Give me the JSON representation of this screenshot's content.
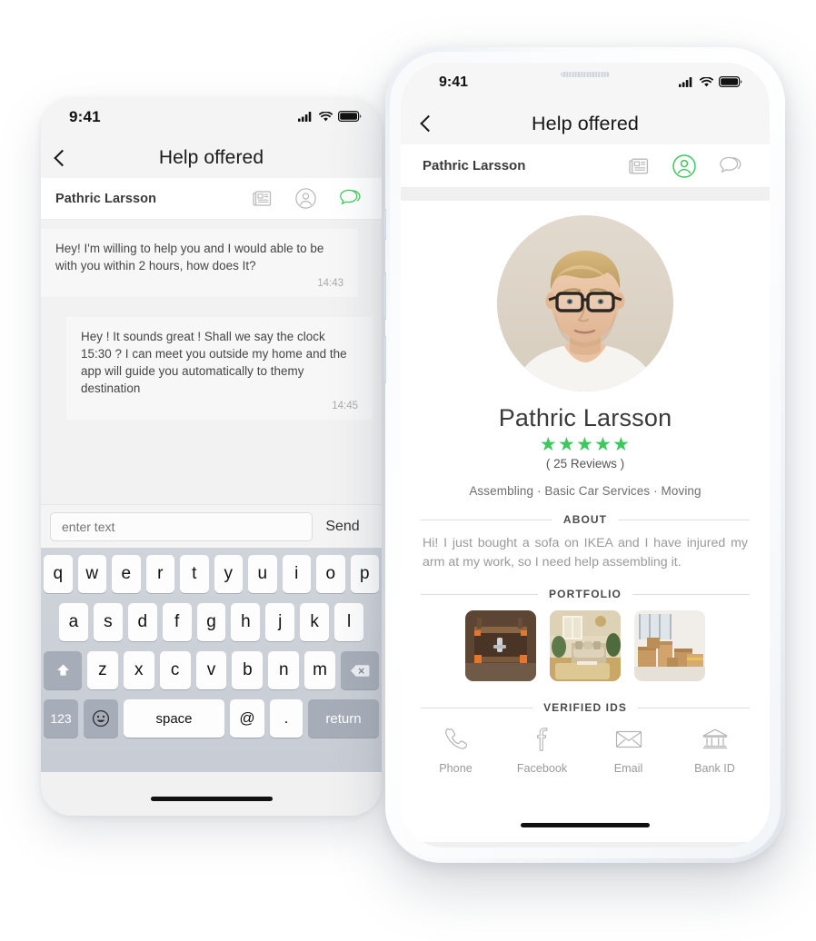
{
  "left_phone": {
    "status_bar": {
      "time": "9:41",
      "signal_icon": "cellular-signal-icon",
      "wifi_icon": "wifi-icon",
      "battery_icon": "battery-icon"
    },
    "nav": {
      "back_icon": "chevron-left-icon",
      "title": "Help offered"
    },
    "sub_bar": {
      "person": "Pathric Larsson",
      "icons": [
        {
          "name": "article-icon",
          "active": false
        },
        {
          "name": "person-circle-icon",
          "active": false
        },
        {
          "name": "chat-bubble-icon",
          "active": true
        }
      ]
    },
    "messages": [
      {
        "direction": "incoming",
        "text": "Hey! I'm willing to help you and I would able to be with you within 2 hours, how does It?",
        "time": "14:43"
      },
      {
        "direction": "outgoing",
        "text": "Hey ! It sounds great ! Shall we say the clock 15:30 ? I can meet you outside my home and the app will guide you automatically to themy destination",
        "time": "14:45"
      }
    ],
    "composer": {
      "placeholder": "enter text",
      "value": "",
      "send_label": "Send"
    },
    "keyboard": {
      "row1": [
        "q",
        "w",
        "e",
        "r",
        "t",
        "y",
        "u",
        "i",
        "o",
        "p"
      ],
      "row2": [
        "a",
        "s",
        "d",
        "f",
        "g",
        "h",
        "j",
        "k",
        "l"
      ],
      "row3": [
        "z",
        "x",
        "c",
        "v",
        "b",
        "n",
        "m"
      ],
      "shift_icon": "shift-arrow-icon",
      "backspace_icon": "backspace-icon",
      "numbers_label": "123",
      "emoji_icon": "smiley-icon",
      "space_label": "space",
      "at_label": "@",
      "dot_label": ".",
      "return_label": "return"
    }
  },
  "right_phone": {
    "status_bar": {
      "time": "9:41",
      "signal_icon": "cellular-signal-icon",
      "wifi_icon": "wifi-icon",
      "battery_icon": "battery-icon"
    },
    "nav": {
      "back_icon": "chevron-left-icon",
      "title": "Help offered"
    },
    "sub_bar": {
      "person": "Pathric Larsson",
      "icons": [
        {
          "name": "article-icon",
          "active": false
        },
        {
          "name": "person-circle-icon",
          "active": true
        },
        {
          "name": "chat-bubble-icon",
          "active": false
        }
      ]
    },
    "profile": {
      "avatar_alt": "profile-photo-man-with-glasses",
      "name": "Pathric Larsson",
      "stars": "★★★★★",
      "rating_value": 5,
      "reviews": "( 25 Reviews )",
      "skills": "Assembling · Basic Car Services · Moving"
    },
    "about": {
      "heading": "ABOUT",
      "text": "Hi! I just bought a sofa on IKEA and I have injured my arm at my work, so I need help assembling it."
    },
    "portfolio": {
      "heading": "PORTFOLIO",
      "items": [
        {
          "name": "portfolio-image-furniture-assembly"
        },
        {
          "name": "portfolio-image-living-room"
        },
        {
          "name": "portfolio-image-moving-boxes"
        }
      ]
    },
    "verified_ids": {
      "heading": "VERIFIED IDS",
      "items": [
        {
          "icon": "phone-icon",
          "label": "Phone"
        },
        {
          "icon": "facebook-icon",
          "label": "Facebook"
        },
        {
          "icon": "email-envelope-icon",
          "label": "Email"
        },
        {
          "icon": "bank-id-icon",
          "label": "Bank ID"
        }
      ]
    }
  },
  "colors": {
    "accent_green": "#3dc75d",
    "text_dark": "#3a3a3a",
    "text_muted": "#9a9a9a",
    "screen_grey": "#f0f0f0",
    "keyboard_grey": "#cfd3da"
  }
}
